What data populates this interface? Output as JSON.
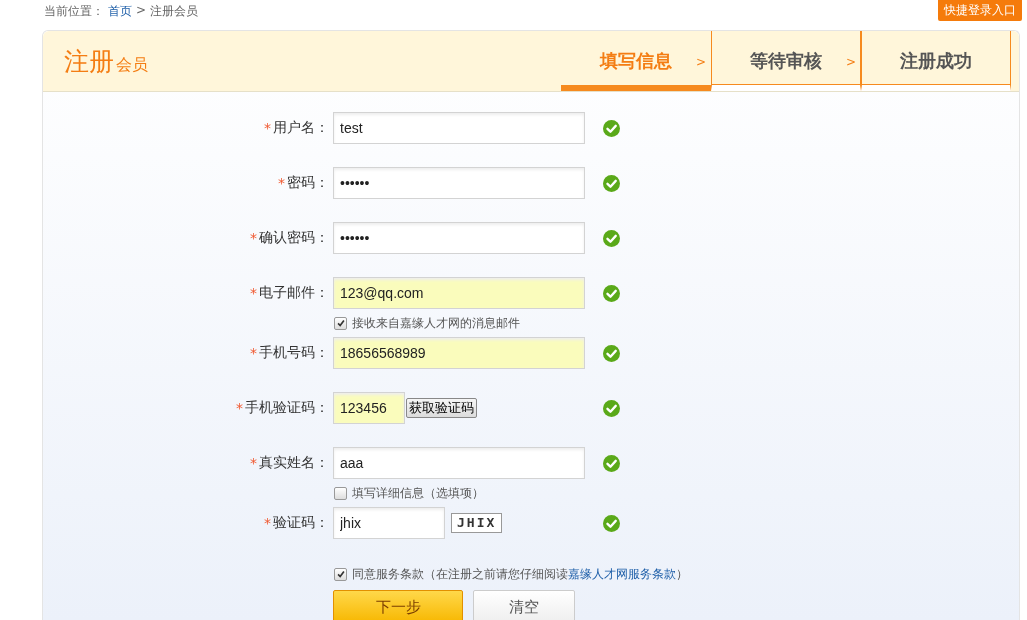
{
  "breadcrumb": {
    "prefix": "当前位置：",
    "home": "首页",
    "separator": ">",
    "current": "注册会员"
  },
  "quick_login_button": "快捷登录入口",
  "title": {
    "main": "注册",
    "sub": "会员"
  },
  "steps": [
    {
      "label": "填写信息",
      "selected": true
    },
    {
      "label": "等待审核",
      "selected": false
    },
    {
      "label": "注册成功",
      "selected": false
    }
  ],
  "step_separators": [
    ">",
    ">"
  ],
  "form_rows": [
    {
      "kind": "text",
      "label": "用户名：",
      "required_mark": "*",
      "value": "test",
      "highlighted": false,
      "valid": true
    },
    {
      "kind": "text",
      "label": "密码：",
      "required_mark": "*",
      "value": "••••••",
      "highlighted": false,
      "valid": true
    },
    {
      "kind": "text",
      "label": "确认密码：",
      "required_mark": "*",
      "value": "••••••",
      "highlighted": false,
      "valid": true
    },
    {
      "kind": "text",
      "label": "电子邮件：",
      "required_mark": "*",
      "value": "123@qq.com",
      "highlighted": true,
      "valid": true
    },
    {
      "kind": "checkbox",
      "label": "接收来自嘉缘人才网的消息邮件",
      "checked": true
    },
    {
      "kind": "text",
      "label": "手机号码：",
      "required_mark": "*",
      "value": "18656568989",
      "highlighted": true,
      "valid": true
    },
    {
      "kind": "sms",
      "label": "手机验证码：",
      "required_mark": "*",
      "value": "123456",
      "highlighted": true,
      "valid": true,
      "button": "获取验证码"
    },
    {
      "kind": "text",
      "label": "真实姓名：",
      "required_mark": "*",
      "value": "aaa",
      "highlighted": false,
      "valid": true
    },
    {
      "kind": "checkbox",
      "label": "填写详细信息（选填项）",
      "checked": false
    },
    {
      "kind": "captcha",
      "label": "验证码：",
      "required_mark": "*",
      "value": "jhix",
      "highlighted": false,
      "valid": true,
      "captcha": "JHIX"
    }
  ],
  "agreement": {
    "checked": true,
    "text": "同意服务条款（在注册之前请您仔细阅读",
    "link": "嘉缘人才网服务条款",
    "suffix": "）"
  },
  "buttons": [
    {
      "kind": "primary",
      "label": "下一步"
    },
    {
      "kind": "secondary",
      "label": "清空"
    }
  ]
}
